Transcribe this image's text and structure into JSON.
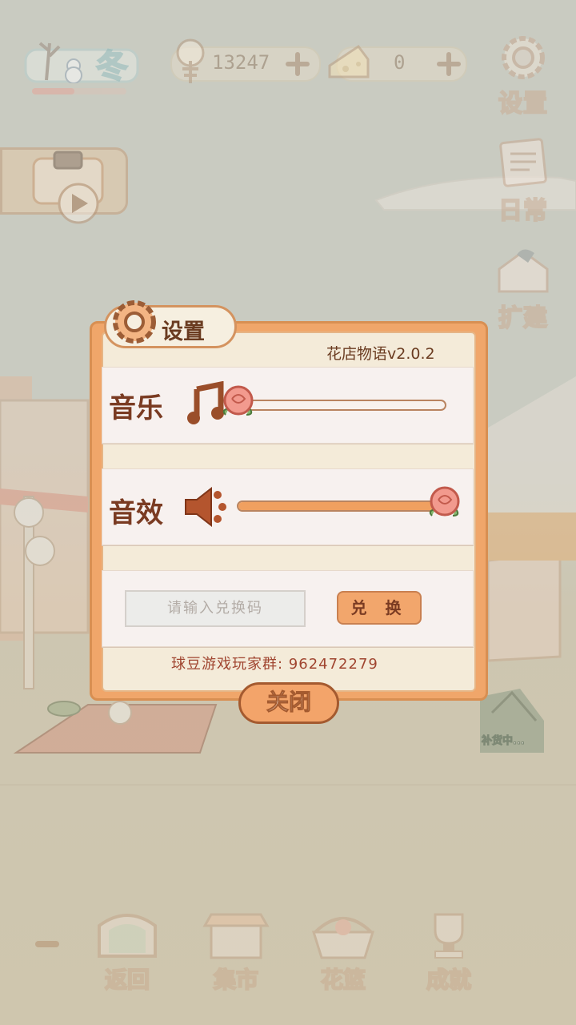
{
  "hud": {
    "season_label": "冬",
    "season_progress": 0.45,
    "fish_count": "13247",
    "cheese_count": "0"
  },
  "side_menu": {
    "settings": "设置",
    "daily": "日常",
    "expand": "扩建"
  },
  "settings_dialog": {
    "title": "设置",
    "version": "花店物语v2.0.2",
    "music_label": "音乐",
    "music_level": 0,
    "sfx_label": "音效",
    "sfx_level": 1,
    "code_placeholder": "请输入兑换码",
    "redeem_label": "兑 换",
    "player_group": "球豆游戏玩家群: 962472279",
    "close_label": "关闭"
  },
  "scene": {
    "shop_sign": "补货中..."
  },
  "bottom_nav": {
    "back": "返回",
    "market": "集市",
    "basket": "花篮",
    "achievements": "成就"
  },
  "colors": {
    "dialog_orange": "#f0a66a",
    "text_brown": "#6a3b20",
    "backdrop": "#c9cbc1"
  }
}
